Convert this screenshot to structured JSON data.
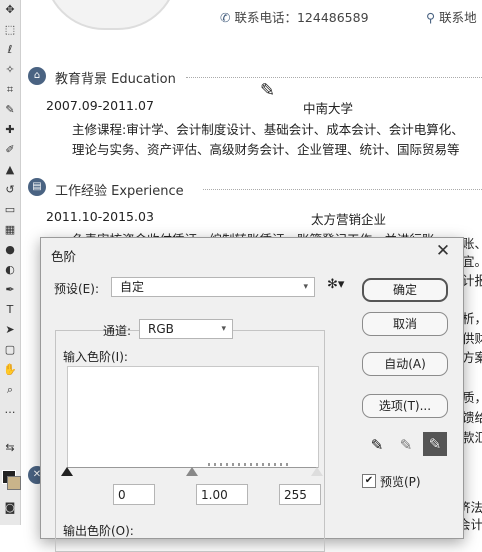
{
  "resume": {
    "contact_phone": "联系电话：124486589",
    "contact_address": "联系地",
    "education": {
      "title": "教育背景 Education",
      "period": "2007.09-2011.07",
      "school": "中南大学",
      "courses_line1": "主修课程:审计学、会计制度设计、基础会计、成本会计、会计电算化、",
      "courses_line2": "理论与实务、资产评估、高级财务会计、企业管理、统计、国际贸易等"
    },
    "experience": {
      "title": "工作经验 Experience",
      "period": "2011.10-2015.03",
      "company": "太方营销企业",
      "line1": "负责审核资金收付凭证、编制转账凭证，账簿登记工作，并进行账",
      "right_fragments": [
        "账、",
        "宜。",
        "计报",
        "析，",
        "供财",
        "方案",
        "质，协",
        "馈给",
        "款汇"
      ],
      "bottom_fragments": [
        "济法",
        "会计"
      ]
    }
  },
  "dialog": {
    "title": "色阶",
    "preset_label": "预设(E):",
    "preset_value": "自定",
    "channel_label": "通道:",
    "channel_value": "RGB",
    "input_levels_label": "输入色阶(I):",
    "output_levels_label": "输出色阶(O):",
    "input_values": [
      "0",
      "1.00",
      "255"
    ],
    "buttons": {
      "ok": "确定",
      "cancel": "取消",
      "auto": "自动(A)",
      "options": "选项(T)..."
    },
    "preview_label": "预览(P)",
    "preview_checked": true
  },
  "icons": {
    "close": "close-icon",
    "gear": "gear-icon",
    "phone": "phone-icon",
    "location": "location-pin-icon",
    "eyedropper": "eyedropper-icon"
  }
}
